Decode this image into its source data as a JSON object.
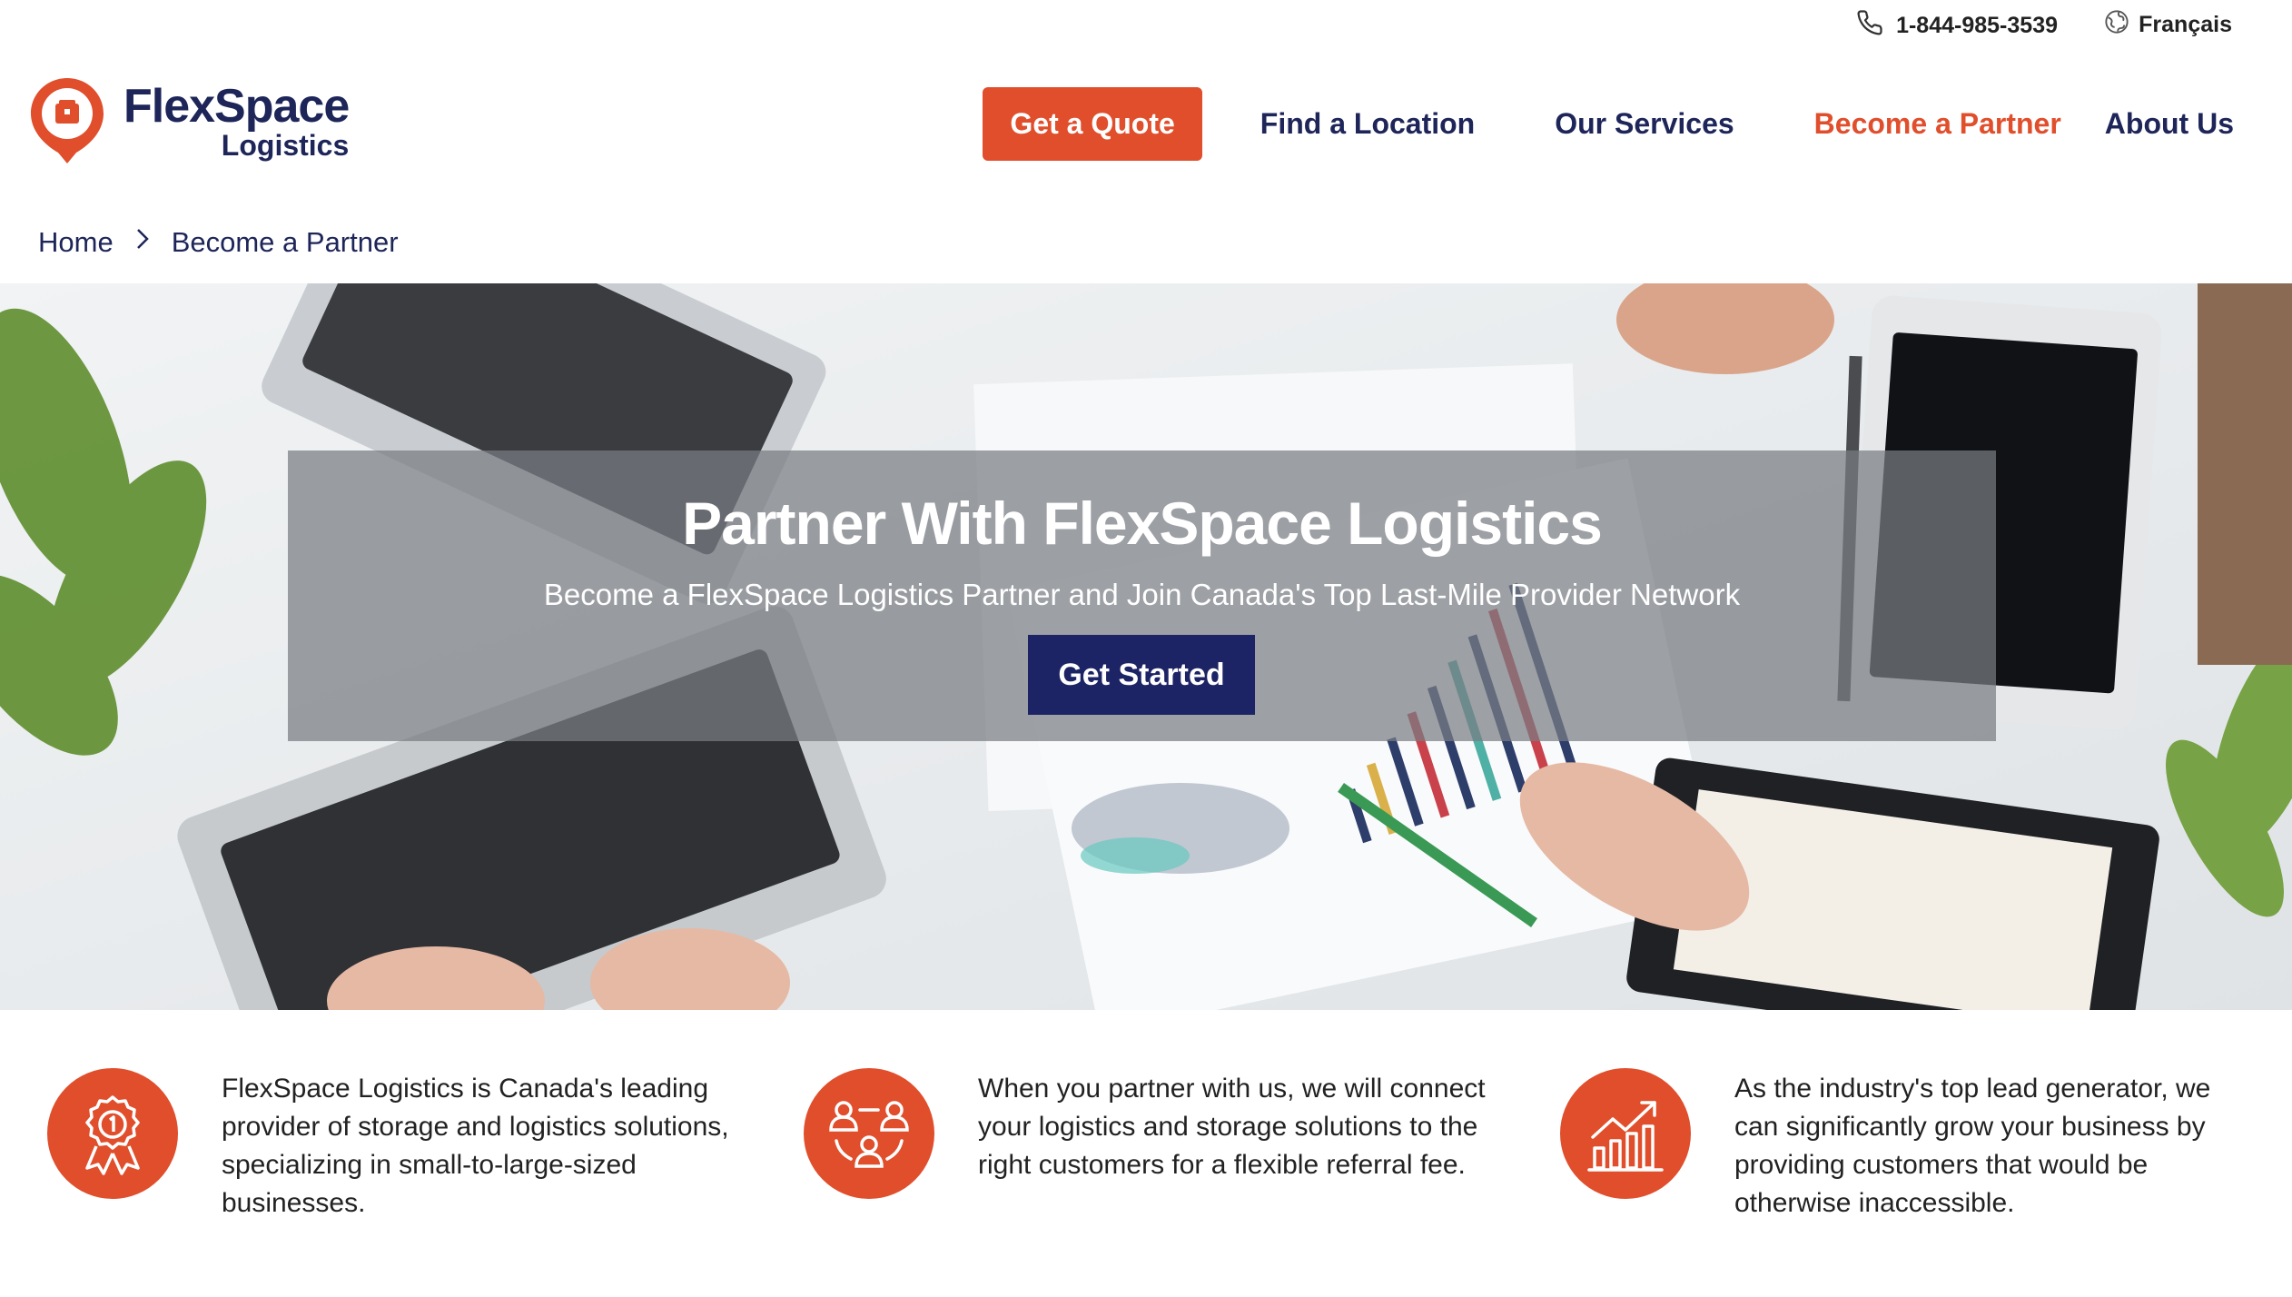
{
  "topbar": {
    "phone": "1-844-985-3539",
    "language": "Français"
  },
  "logo": {
    "main": "FlexSpace",
    "sub": "Logistics"
  },
  "nav": {
    "quote": "Get a Quote",
    "items": [
      "Find a Location",
      "Our Services",
      "Become a Partner",
      "About Us"
    ]
  },
  "breadcrumb": {
    "home": "Home",
    "current": "Become a Partner"
  },
  "hero": {
    "title": "Partner With FlexSpace Logistics",
    "subtitle": "Become a FlexSpace Logistics Partner and Join Canada's Top Last-Mile Provider Network",
    "button": "Get Started"
  },
  "features": [
    {
      "icon": "award-ribbon-icon",
      "text": "FlexSpace Logistics is Canada's leading provider of storage and logistics solutions, specializing in small-to-large-sized businesses."
    },
    {
      "icon": "people-network-icon",
      "text": "When you partner with us, we will connect your logistics and storage solutions to the right customers for a flexible referral fee."
    },
    {
      "icon": "growth-chart-icon",
      "text": "As the industry's top lead generator, we can significantly grow your business by providing customers that would be otherwise inaccessible."
    }
  ],
  "colors": {
    "brand_orange": "#e04e2c",
    "navy": "#1d2559",
    "button_navy": "#1d2465"
  }
}
